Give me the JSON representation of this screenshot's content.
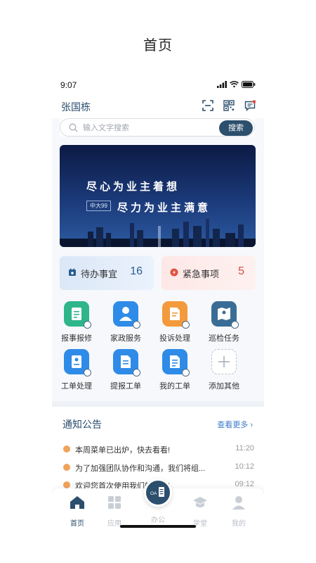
{
  "page_caption": "首页",
  "status_bar": {
    "time": "9:07"
  },
  "header": {
    "user_name": "张国栋"
  },
  "search": {
    "placeholder": "输入文字搜索",
    "button_label": "搜索"
  },
  "banner": {
    "line1": "尽心为业主着想",
    "line2": "尽力为业主满意",
    "tag": "中大99"
  },
  "cards": [
    {
      "label": "待办事宜",
      "count": "16"
    },
    {
      "label": "紧急事项",
      "count": "5"
    }
  ],
  "grid_items": [
    {
      "label": "报事报修",
      "icon": "repair-icon",
      "color": "#2fb58a"
    },
    {
      "label": "家政服务",
      "icon": "housekeeping-icon",
      "color": "#2e8be8"
    },
    {
      "label": "投诉处理",
      "icon": "complaint-icon",
      "color": "#f39a3c"
    },
    {
      "label": "巡检任务",
      "icon": "patrol-map-icon",
      "color": "#3a6d96"
    },
    {
      "label": "工单处理",
      "icon": "work-order-icon",
      "color": "#2e8be8"
    },
    {
      "label": "提报工单",
      "icon": "submit-order-icon",
      "color": "#2e8be8"
    },
    {
      "label": "我的工单",
      "icon": "my-orders-icon",
      "color": "#2e8be8"
    },
    {
      "label": "添加其他",
      "icon": "plus-icon",
      "color": "#b9c2cc"
    }
  ],
  "notice": {
    "title": "通知公告",
    "more_label": "查看更多",
    "items": [
      {
        "text": "本周菜单已出炉，快去看看!",
        "time": "11:20"
      },
      {
        "text": "为了加强团队协作和沟通，我们将组...",
        "time": "10:12"
      },
      {
        "text": "欢迎您首次使用我们的APP!",
        "time": "09:12"
      }
    ]
  },
  "tabbar": {
    "items": [
      {
        "label": "首页",
        "icon": "home-icon",
        "active": true
      },
      {
        "label": "应用",
        "icon": "apps-icon",
        "active": false
      },
      {
        "label": "办公",
        "icon": "office-oa-icon",
        "active": false
      },
      {
        "label": "学堂",
        "icon": "graduation-cap-icon",
        "active": false
      },
      {
        "label": "我的",
        "icon": "profile-icon",
        "active": false
      }
    ],
    "center_badge": "OA"
  },
  "colors": {
    "primary": "#2c4f6d",
    "accent_link": "#3a7bc8",
    "urgent": "#d94b3c",
    "notice_dot": "#f0a35a"
  }
}
